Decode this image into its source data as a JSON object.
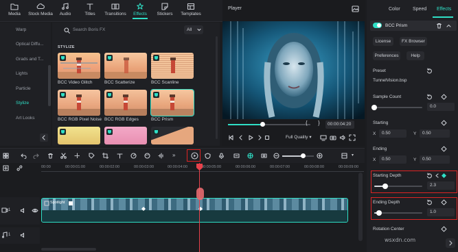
{
  "top_tabs": [
    {
      "label": "Media",
      "icon": "folder-icon"
    },
    {
      "label": "Stock Media",
      "icon": "cloud-icon"
    },
    {
      "label": "Audio",
      "icon": "music-icon"
    },
    {
      "label": "Titles",
      "icon": "text-icon"
    },
    {
      "label": "Transitions",
      "icon": "transition-icon"
    },
    {
      "label": "Effects",
      "icon": "effects-icon",
      "active": true
    },
    {
      "label": "Stickers",
      "icon": "sticker-icon"
    },
    {
      "label": "Templates",
      "icon": "template-icon"
    }
  ],
  "sidebar": {
    "items": [
      "Warp",
      "Optical Diffu...",
      "Grads and T...",
      "Lights",
      "Particle",
      "Stylize",
      "Art Looks"
    ],
    "active": "Stylize"
  },
  "browser": {
    "search_placeholder": "Search Boris FX",
    "filter_value": "All",
    "section_label": "STYLIZE",
    "effects": [
      {
        "label": "BCC Video Glitch"
      },
      {
        "label": "BCC Scatterize"
      },
      {
        "label": "BCC Scanline"
      },
      {
        "label": "BCC RGB Pixel Noise"
      },
      {
        "label": "BCC RGB Edges"
      },
      {
        "label": "BCC Prism",
        "selected": true
      }
    ]
  },
  "player": {
    "title": "Player",
    "timecode": "00:00:04:20",
    "quality": "Full Quality",
    "progress": 0.42
  },
  "right_panel": {
    "tabs": [
      "Color",
      "Speed",
      "Effects"
    ],
    "active_tab": "Effects",
    "effect_name": "BCC Prism",
    "effect_enabled": true,
    "buttons": {
      "license": "License",
      "fx_browser": "FX Browser",
      "preferences": "Preferences",
      "help": "Help"
    },
    "preset": {
      "label": "Preset",
      "value": "TunnelVision.bsp"
    },
    "sample_count": {
      "label": "Sample Count",
      "value": "0.0",
      "fraction": 0.0
    },
    "starting": {
      "label": "Starting",
      "x_label": "X",
      "x": "0.50",
      "y_label": "Y",
      "y": "0.50"
    },
    "ending": {
      "label": "Ending",
      "x_label": "X",
      "x": "0.50",
      "y_label": "Y",
      "y": "0.50"
    },
    "starting_depth": {
      "label": "Starting Depth",
      "value": "2.3",
      "fraction": 0.23
    },
    "ending_depth": {
      "label": "Ending Depth",
      "value": "1.0",
      "fraction": 0.1
    },
    "rotation_center": {
      "label": "Rotation Center"
    }
  },
  "timeline": {
    "ruler_labels": [
      "00:00",
      "00:00:01:00",
      "00:00:02:00",
      "00:00:03:00",
      "00:00:04:00",
      "00:00:05:00",
      "00:00:06:00",
      "00:00:07:00",
      "00:00:08:00",
      "00:00:09:00"
    ],
    "clip_label": "Spotlight",
    "track_labels": [
      "1",
      "1"
    ]
  },
  "watermark": "wsxdn.com",
  "colors": {
    "accent": "#2fe0c7",
    "playhead": "#e8414b",
    "highlight": "#e02424"
  }
}
